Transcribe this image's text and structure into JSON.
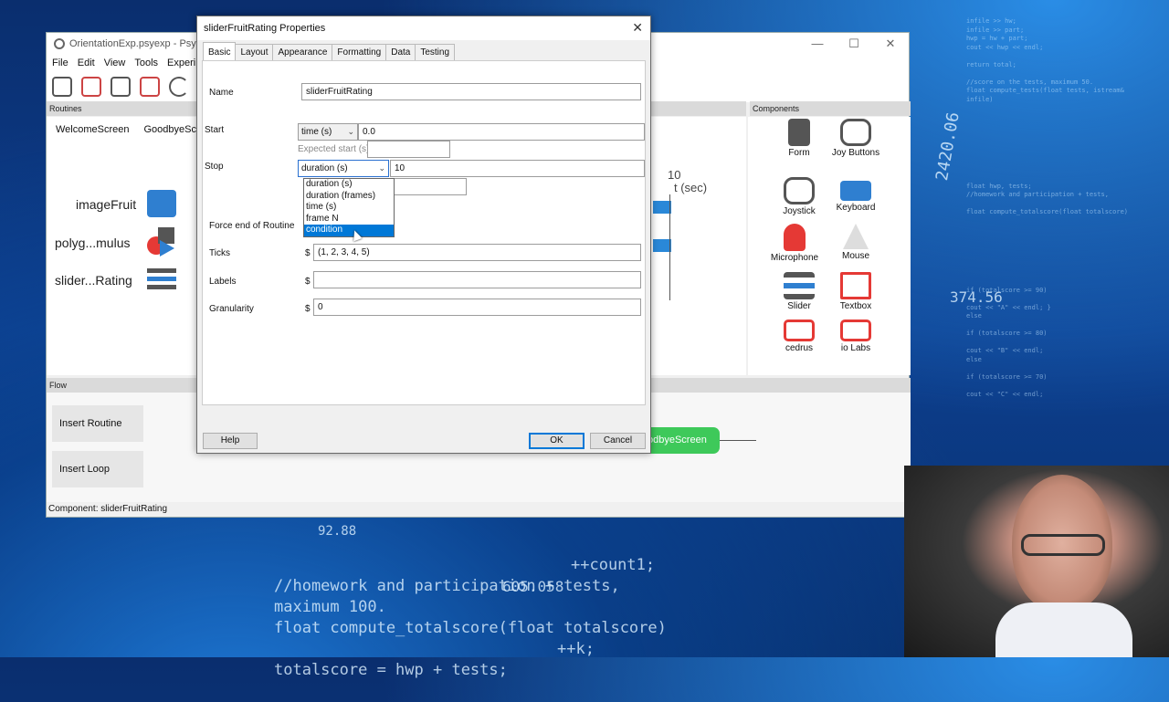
{
  "app": {
    "title": "OrientationExp.psyexp - PsychoP",
    "menu": [
      "File",
      "Edit",
      "View",
      "Tools",
      "Experime"
    ],
    "window_controls": [
      "—",
      "☐",
      "✕"
    ]
  },
  "routines": {
    "header": "Routines",
    "tabs": [
      "WelcomeScreen",
      "GoodbyeScree"
    ],
    "items": [
      "imageFruit",
      "polyg...mulus",
      "slider...Rating"
    ],
    "timeline_tick": "10",
    "timeline_unit": "t (sec)"
  },
  "components": {
    "header": "Components",
    "items": [
      "Form",
      "Joy Buttons",
      "Joystick",
      "Keyboard",
      "Microphone",
      "Mouse",
      "Slider",
      "Textbox",
      "cedrus",
      "io Labs"
    ]
  },
  "flow": {
    "header": "Flow",
    "insert_routine": "Insert Routine",
    "insert_loop": "Insert Loop",
    "goodbye_node": "odbyeScreen"
  },
  "status": "Component: sliderFruitRating",
  "dialog": {
    "title": "sliderFruitRating Properties",
    "tabs": [
      "Basic",
      "Layout",
      "Appearance",
      "Formatting",
      "Data",
      "Testing"
    ],
    "fields": {
      "name_label": "Name",
      "name_value": "sliderFruitRating",
      "start_label": "Start",
      "start_type": "time (s)",
      "start_value": "0.0",
      "expected_start": "Expected start (s)",
      "stop_label": "Stop",
      "stop_type": "duration (s)",
      "stop_value": "10",
      "force_end_label": "Force end of Routine",
      "ticks_label": "Ticks",
      "ticks_value": "(1, 2, 3, 4, 5)",
      "labels_label": "Labels",
      "labels_value": "",
      "granularity_label": "Granularity",
      "granularity_value": "0",
      "dollar": "$"
    },
    "dropdown_options": [
      "duration (s)",
      "duration (frames)",
      "time (s)",
      "frame N",
      "condition"
    ],
    "dropdown_selected": "condition",
    "buttons": {
      "help": "Help",
      "ok": "OK",
      "cancel": "Cancel"
    }
  },
  "background_code": [
    "infile >> hw;",
    "infile >> part;",
    "hwp = hw + part;",
    "cout << hwp << endl;",
    "return total;",
    "//score on the tests, maximum 50.",
    "float compute_tests(float tests, istream&",
    "infile)",
    "float hwp, tests;",
    "//homework and participation + tests,",
    "float compute_totalscore(float totalscore)",
    "if (totalscore >= 90)",
    "cout << \"A\" << endl; }",
    "else",
    "if (totalscore >= 80)",
    "cout << \"B\" << endl;",
    "if (totalscore >= 70)",
    "cout << \"C\" << endl;"
  ],
  "background_big": [
    "++count1;",
    "//homework and participation + tests,",
    "maximum 100.",
    "float compute_totalscore(float totalscore)",
    "++k;",
    "totalscore = hwp + tests;",
    "605.058",
    "92.88",
    "374.56",
    "2420.06"
  ]
}
